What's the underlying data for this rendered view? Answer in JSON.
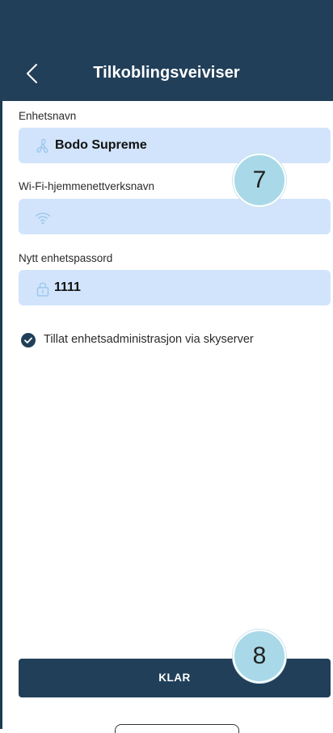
{
  "header": {
    "title": "Tilkoblingsveiviser"
  },
  "form": {
    "device_name_label": "Enhetsnavn",
    "device_name_value": "Bodo Supreme",
    "wifi_label": "Wi-Fi-hjemmenettverksnavn",
    "wifi_value": "",
    "password_label": "Nytt enhetspassord",
    "password_value": "1111",
    "cloud_checkbox_label": "Tillat enhetsadministrasjon via skyserver",
    "cloud_checked": true
  },
  "annotations": {
    "badge_top": "7",
    "badge_bottom": "8"
  },
  "footer": {
    "done_label": "KLAR"
  },
  "colors": {
    "header": "#213f59",
    "field_bg": "#d2e4fb",
    "badge": "#a9d9e8",
    "icon": "#9cc7ef"
  },
  "icons": [
    "chevron-left-icon",
    "fan-icon",
    "wifi-icon",
    "lock-icon",
    "check-circle-icon"
  ]
}
